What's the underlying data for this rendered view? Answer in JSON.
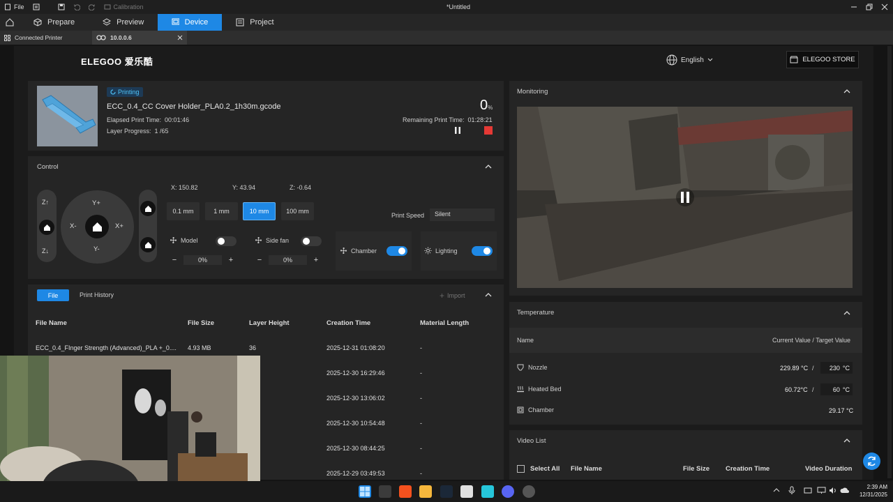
{
  "titlebar": {
    "file": "File",
    "calibration": "Calibration",
    "title": "*Untitled"
  },
  "tabs": {
    "prepare": "Prepare",
    "preview": "Preview",
    "device": "Device",
    "project": "Project"
  },
  "subtabs": {
    "connected": "Connected Printer",
    "ip": "10.0.0.6"
  },
  "brand": {
    "logo": "ELEGOO 爱乐酷",
    "language": "English",
    "store": "ELEGOO STORE"
  },
  "job": {
    "status": "Printing",
    "filename": "ECC_0.4_CC Cover Holder_PLA0.2_1h30m.gcode",
    "elapsed_label": "Elapsed Print Time:",
    "elapsed_value": "00:01:46",
    "layer_label": "Layer Progress:",
    "layer_value": "1 /65",
    "percent": "0",
    "percent_unit": "%",
    "remaining_label": "Remaining Print Time:",
    "remaining_value": "01:28:21"
  },
  "control": {
    "title": "Control",
    "z_up": "Z↑",
    "z_down": "Z↓",
    "y_plus": "Y+",
    "y_minus": "Y-",
    "x_minus": "X-",
    "x_plus": "X+",
    "x_coord": "X:  150.82",
    "y_coord": "Y:  43.94",
    "z_coord": "Z:  -0.64",
    "steps": [
      "0.1 mm",
      "1 mm",
      "10 mm",
      "100 mm"
    ],
    "selected_step": "10 mm",
    "print_speed_label": "Print Speed",
    "print_speed_value": "Silent",
    "model_fan_label": "Model",
    "model_fan_value": "0%",
    "side_fan_label": "Side fan",
    "side_fan_value": "0%",
    "chamber_label": "Chamber",
    "chamber_on": true,
    "lighting_label": "Lighting",
    "lighting_on": true,
    "minus": "−",
    "plus": "+"
  },
  "files": {
    "tab_file": "File",
    "tab_history": "Print History",
    "import": "Import",
    "columns": [
      "File Name",
      "File Size",
      "Layer Height",
      "Creation Time",
      "Material Length"
    ],
    "rows": [
      {
        "name": "ECC_0.4_FInger Strength (Advanced)_PLA +_0....",
        "size": "4.93 MB",
        "layer": "36",
        "time": "2025-12-31 01:08:20",
        "length": "-"
      },
      {
        "name": "",
        "size": "",
        "layer": "",
        "time": "2025-12-30 16:29:46",
        "length": "-"
      },
      {
        "name": "",
        "size": "",
        "layer": "",
        "time": "2025-12-30 13:06:02",
        "length": "-"
      },
      {
        "name": "",
        "size": "",
        "layer": "",
        "time": "2025-12-30 10:54:48",
        "length": "-"
      },
      {
        "name": "",
        "size": "",
        "layer": "",
        "time": "2025-12-30 08:44:25",
        "length": "-"
      },
      {
        "name": "",
        "size": "",
        "layer": "",
        "time": "2025-12-29 03:49:53",
        "length": "-"
      }
    ]
  },
  "monitoring": {
    "title": "Monitoring"
  },
  "temperature": {
    "title": "Temperature",
    "col_name": "Name",
    "col_value": "Current Value / Target Value",
    "nozzle_label": "Nozzle",
    "nozzle_current": "229.89 °C",
    "nozzle_target": "230",
    "unit": "°C",
    "bed_label": "Heated Bed",
    "bed_current": "60.72°C",
    "bed_target": "60",
    "chamber_label": "Chamber",
    "chamber_current": "29.17 °C",
    "slash": "/"
  },
  "video_list": {
    "title": "Video List",
    "select_all": "Select All",
    "columns": [
      "File Name",
      "File Size",
      "Creation Time",
      "Video Duration"
    ]
  },
  "clock": {
    "time": "2:39 AM",
    "date": "12/31/2025"
  },
  "colors": {
    "accent": "#1e88e5",
    "stop": "#e53935",
    "panel": "#252525",
    "model": "#4fa3d9"
  }
}
